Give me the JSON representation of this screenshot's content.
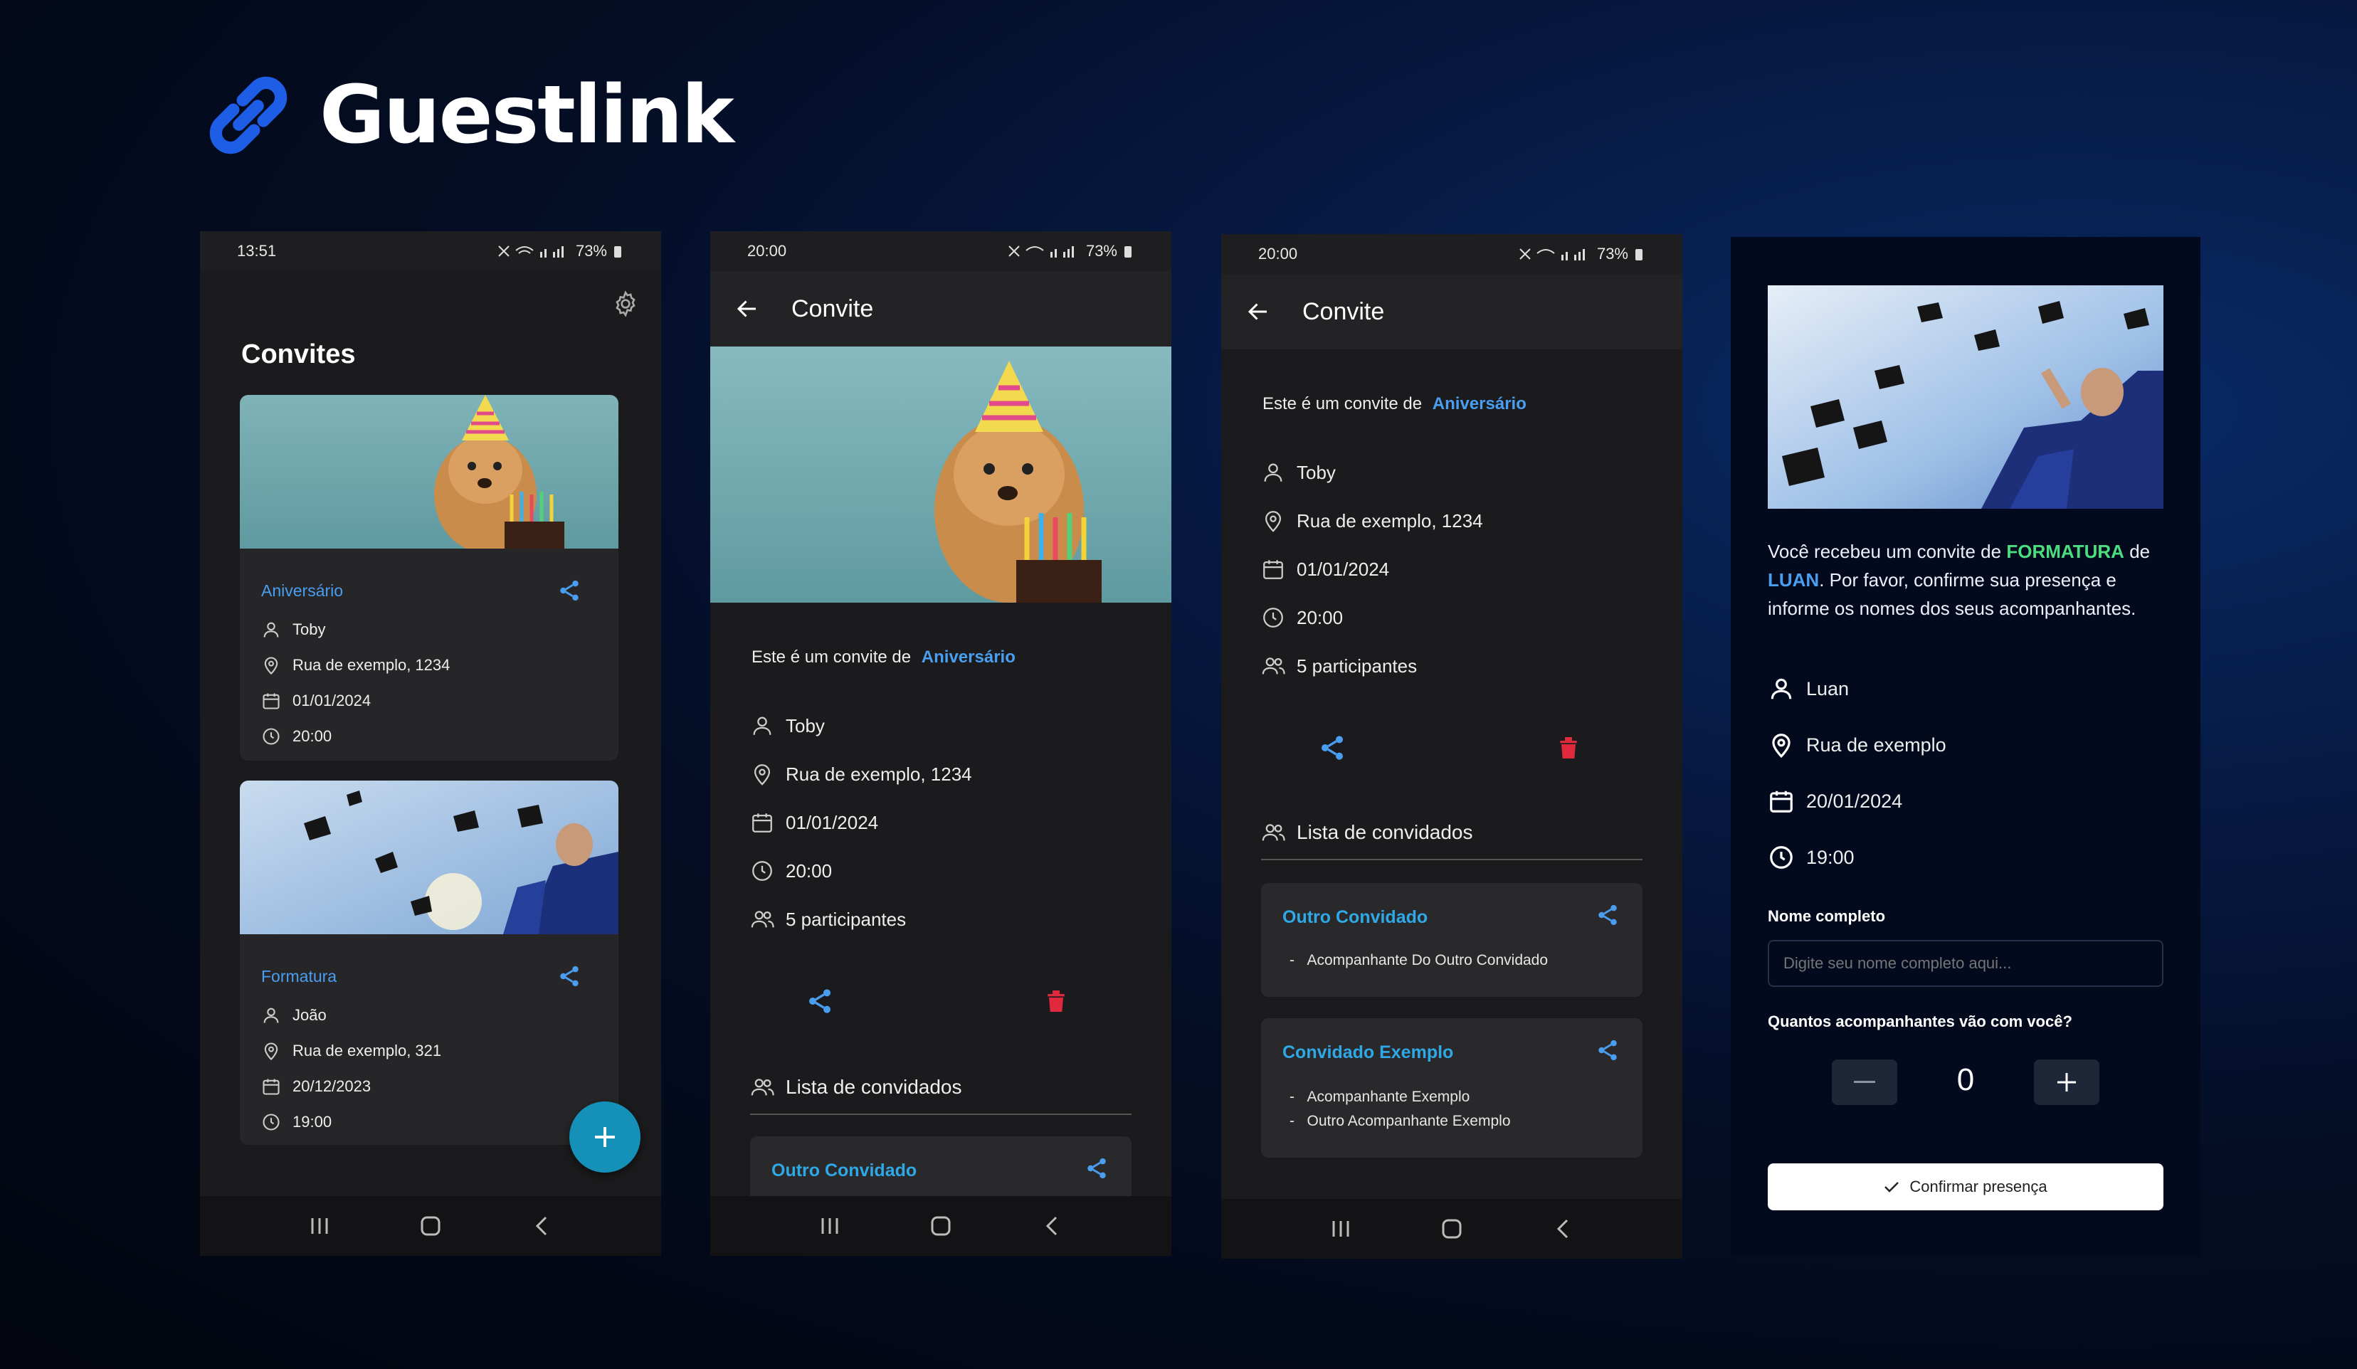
{
  "brand": {
    "name": "Guestlink",
    "accent": "#1e5ee6"
  },
  "phone1": {
    "time": "13:51",
    "battery": "73%",
    "page_title": "Convites",
    "cards": [
      {
        "title": "Aniversário",
        "host": "Toby",
        "address": "Rua de exemplo, 1234",
        "date": "01/01/2024",
        "time": "20:00"
      },
      {
        "title": "Formatura",
        "host": "João",
        "address": "Rua de exemplo, 321",
        "date": "20/12/2023",
        "time": "19:00"
      }
    ]
  },
  "phone2": {
    "time": "20:00",
    "battery": "73%",
    "toolbar_title": "Convite",
    "intro": "Este é um convite de",
    "event": "Aniversário",
    "host": "Toby",
    "address": "Rua de exemplo, 1234",
    "date": "01/01/2024",
    "participants": "5 participantes",
    "guest_list_title": "Lista de convidados",
    "guests": [
      {
        "name": "Outro Convidado"
      }
    ]
  },
  "phone3": {
    "time": "20:00",
    "battery": "73%",
    "toolbar_title": "Convite",
    "intro": "Este é um convite de",
    "event": "Aniversário",
    "host": "Toby",
    "address": "Rua de exemplo, 1234",
    "date": "01/01/2024",
    "participants": "5 participantes",
    "guest_list_title": "Lista de convidados",
    "guests": [
      {
        "name": "Outro Convidado",
        "companions": [
          "Acompanhante Do Outro Convidado"
        ]
      },
      {
        "name": "Convidado Exemplo",
        "companions": [
          "Acompanhante Exemplo",
          "Outro Acompanhante Exemplo"
        ]
      }
    ]
  },
  "web": {
    "msg_part1": "Você recebeu um convite de",
    "event": "FORMATURA",
    "msg_part2": "de",
    "host_name": "LUAN",
    "msg_part3": ". Por favor, confirme sua presença e informe os nomes dos seus acompanhantes.",
    "host": "Luan",
    "address": "Rua de exemplo",
    "date": "20/01/2024",
    "time": "19:00",
    "name_label": "Nome completo",
    "name_placeholder": "Digite seu nome completo aqui...",
    "companions_label": "Quantos acompanhantes vão com você?",
    "companions_count": "0",
    "confirm_label": "Confirmar presença"
  },
  "colors": {
    "link_blue": "#4a9ef0",
    "delete_red": "#e0293d",
    "fab": "#1590b8",
    "formatura_green": "#4ade80"
  }
}
